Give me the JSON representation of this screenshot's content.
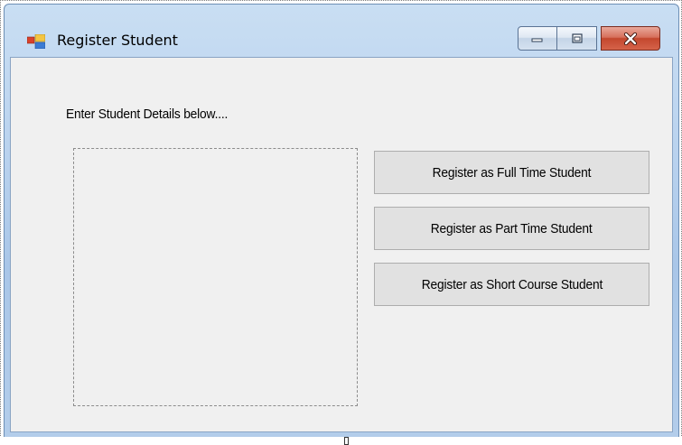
{
  "window": {
    "title": "Register Student",
    "app_icon": "windows-form-icon",
    "controls": {
      "minimize_icon": "minimize-icon",
      "maximize_icon": "maximize-icon",
      "close_icon": "close-icon"
    }
  },
  "form": {
    "instruction_label": "Enter Student Details below....",
    "buttons": {
      "full_time": "Register as Full Time Student",
      "part_time": "Register as Part Time Student",
      "short_course": "Register as Short Course Student"
    }
  },
  "colors": {
    "title_gradient_top": "#c9def3",
    "client_background": "#f0f0f0",
    "button_background": "#e1e1e1",
    "close_button_red": "#c3472e"
  }
}
